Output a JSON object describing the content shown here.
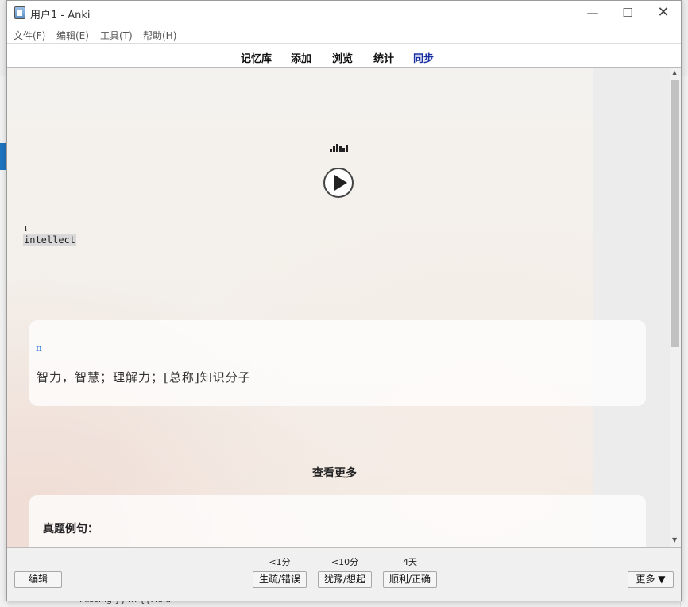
{
  "window": {
    "title": "用户1 - Anki",
    "minimize_glyph": "—",
    "maximize_glyph": "☐",
    "close_glyph": "✕"
  },
  "menu": {
    "items": [
      {
        "label": "文件(F)"
      },
      {
        "label": "编辑(E)"
      },
      {
        "label": "工具(T)"
      },
      {
        "label": "帮助(H)"
      }
    ]
  },
  "toolbar": {
    "items": [
      {
        "label": "记忆库"
      },
      {
        "label": "添加"
      },
      {
        "label": "浏览"
      },
      {
        "label": "统计"
      },
      {
        "label": "同步"
      }
    ]
  },
  "card": {
    "arrow": "↓",
    "word": "intellect",
    "part_of_speech": "n",
    "meaning": "智力，智慧；理解力；[总称]知识分子",
    "more_link": "查看更多",
    "example_title": "真题例句："
  },
  "bottom": {
    "edit_button": "编辑",
    "answers": [
      {
        "interval": "<1分",
        "label": "生疏/错误"
      },
      {
        "interval": "<10分",
        "label": "犹豫/想起"
      },
      {
        "interval": "4天",
        "label": "顺利/正确"
      }
    ],
    "more_button": "更多 ▼"
  },
  "scroll": {
    "up_glyph": "▲",
    "down_glyph": "▼"
  },
  "background": {
    "bottom_text": "Missing }} in {{Field"
  }
}
